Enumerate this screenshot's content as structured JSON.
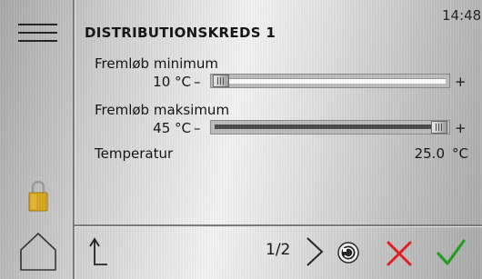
{
  "header": {
    "time": "14:48",
    "title": "DISTRIBUTIONSKREDS 1"
  },
  "settings": [
    {
      "label": "Fremløb minimum",
      "value": "10 °C",
      "minus": "–",
      "plus": "+",
      "level": 0.0
    },
    {
      "label": "Fremløb maksimum",
      "value": "45 °C",
      "minus": "–",
      "plus": "+",
      "level": 1.0
    }
  ],
  "temperature": {
    "label": "Temperatur",
    "value": "25.0",
    "unit": "°C"
  },
  "footer": {
    "page": "1/2"
  },
  "icons": {
    "menu": "hamburger-menu-icon",
    "lock": "padlock-icon",
    "home": "home-icon",
    "back": "up-arrow-icon",
    "next": "chevron-right-icon",
    "reset": "reset-icon",
    "cancel": "cross-icon",
    "confirm": "checkmark-icon"
  },
  "colors": {
    "lock": "#d9a61f",
    "cancel": "#e21c1c",
    "confirm": "#1fa01f",
    "slider_empty": "#ffffff",
    "slider_full": "#4a4a4a"
  }
}
